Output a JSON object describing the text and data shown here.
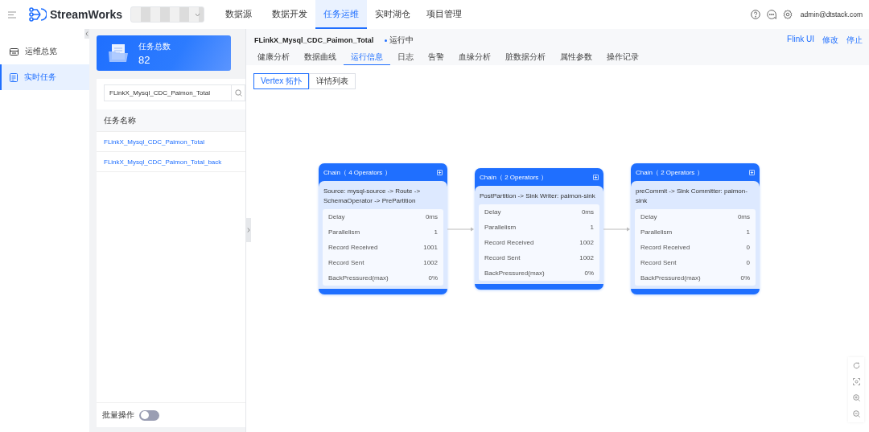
{
  "header": {
    "app_name": "StreamWorks",
    "nav": [
      {
        "label": "数据源",
        "selected": false
      },
      {
        "label": "数据开发",
        "selected": false
      },
      {
        "label": "任务运维",
        "selected": true
      },
      {
        "label": "实时湖仓",
        "selected": false
      },
      {
        "label": "项目管理",
        "selected": false
      }
    ],
    "user": "admin@dtstack.com"
  },
  "sidebar": {
    "items": [
      {
        "label": "运维总览",
        "selected": false
      },
      {
        "label": "实时任务",
        "selected": true
      }
    ]
  },
  "task_panel": {
    "stat": {
      "label": "任务总数",
      "value": "82"
    },
    "search": {
      "value": "FLinkX_Mysql_CDC_Paimon_Total"
    },
    "column": "任务名称",
    "rows": [
      "FLinkX_Mysql_CDC_Paimon_Total",
      "FLinkX_Mysql_CDC_Paimon_Total_back"
    ],
    "batch": {
      "label": "批量操作",
      "on": false
    }
  },
  "detail": {
    "title": "FLinkX_Mysql_CDC_Paimon_Total",
    "status": "运行中",
    "actions": [
      "Flink UI",
      "修改",
      "停止"
    ],
    "tabs": [
      {
        "label": "健康分析",
        "selected": false
      },
      {
        "label": "数据曲线",
        "selected": false
      },
      {
        "label": "运行信息",
        "selected": true
      },
      {
        "label": "日志",
        "selected": false
      },
      {
        "label": "告警",
        "selected": false
      },
      {
        "label": "血缘分析",
        "selected": false
      },
      {
        "label": "脏数据分析",
        "selected": false
      },
      {
        "label": "属性参数",
        "selected": false
      },
      {
        "label": "操作记录",
        "selected": false
      }
    ],
    "view_tabs": [
      {
        "label": "Vertex 拓扑",
        "selected": true
      },
      {
        "label": "详情列表",
        "selected": false
      }
    ],
    "chains": [
      {
        "title": "Chain（ 4 Operators ）",
        "operators": "Source: mysql-source -> Route -> SchemaOperator -> PrePartition",
        "metrics": [
          {
            "name": "Delay",
            "value": "0ms"
          },
          {
            "name": "Parallelism",
            "value": "1"
          },
          {
            "name": "Record Received",
            "value": "1001"
          },
          {
            "name": "Record Sent",
            "value": "1002"
          },
          {
            "name": "BackPressured(max)",
            "value": "0%"
          }
        ]
      },
      {
        "title": "Chain（ 2 Operators ）",
        "operators": "PostPartition -> Sink Writer: paimon-sink",
        "metrics": [
          {
            "name": "Delay",
            "value": "0ms"
          },
          {
            "name": "Parallelism",
            "value": "1"
          },
          {
            "name": "Record Received",
            "value": "1002"
          },
          {
            "name": "Record Sent",
            "value": "1002"
          },
          {
            "name": "BackPressured(max)",
            "value": "0%"
          }
        ]
      },
      {
        "title": "Chain（ 2 Operators ）",
        "operators": "preCommit -> Sink Committer: paimon-sink",
        "metrics": [
          {
            "name": "Delay",
            "value": "0ms"
          },
          {
            "name": "Parallelism",
            "value": "1"
          },
          {
            "name": "Record Received",
            "value": "0"
          },
          {
            "name": "Record Sent",
            "value": "0"
          },
          {
            "name": "BackPressured(max)",
            "value": "0%"
          }
        ]
      }
    ]
  }
}
